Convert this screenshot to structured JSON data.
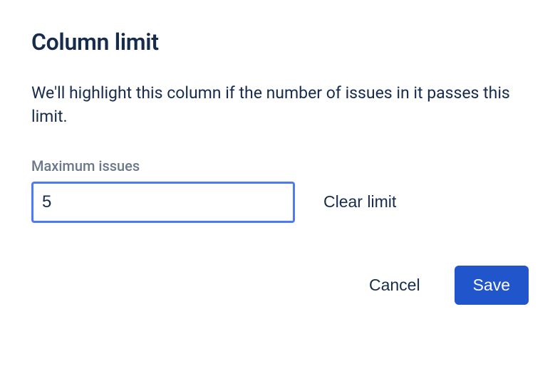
{
  "dialog": {
    "title": "Column limit",
    "description": "We'll highlight this column if the number of issues in it passes this limit.",
    "field_label": "Maximum issues",
    "input_value": "5",
    "clear_label": "Clear limit",
    "cancel_label": "Cancel",
    "save_label": "Save"
  }
}
